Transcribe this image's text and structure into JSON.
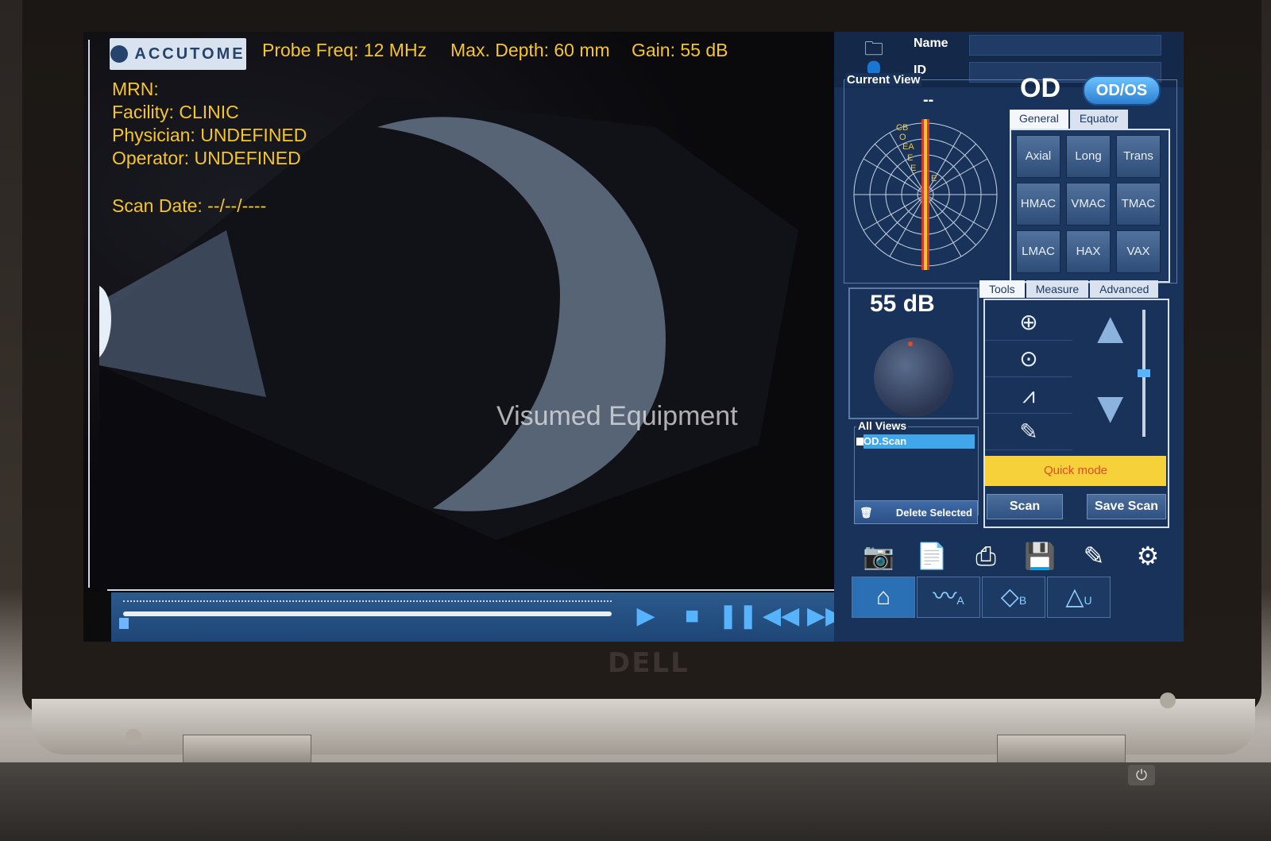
{
  "laptop": {
    "brand": "DELL",
    "power_icon": "power-icon"
  },
  "header": {
    "logo": "ACCUTOME",
    "probe_freq": "Probe Freq: 12 MHz",
    "max_depth": "Max. Depth: 60 mm",
    "gain": "Gain: 55 dB"
  },
  "patient_info": {
    "mrn": "MRN:",
    "facility": "Facility: CLINIC",
    "physician": "Physician: UNDEFINED",
    "operator": "Operator: UNDEFINED",
    "scan_date": "Scan Date: --/--/----"
  },
  "watermark": "Visumed Equipment",
  "patient_fields": {
    "name_label": "Name",
    "id_label": "ID"
  },
  "current_view": {
    "label": "Current View",
    "eye": "OD",
    "toggle": "OD/OS",
    "dash": "--",
    "clock_labels": [
      "CB",
      "O",
      "EA",
      "E",
      "E",
      "E"
    ]
  },
  "view_tabs": [
    "General",
    "Equator"
  ],
  "view_buttons": [
    "Axial",
    "Long",
    "Trans",
    "HMAC",
    "VMAC",
    "TMAC",
    "LMAC",
    "HAX",
    "VAX"
  ],
  "gain_panel": {
    "value": "55 dB"
  },
  "all_views": {
    "label": "All Views",
    "items": [
      "OD.Scan"
    ],
    "delete": "Delete Selected"
  },
  "tools_tabs": [
    "Tools",
    "Measure",
    "Advanced"
  ],
  "tools": {
    "quick_mode": "Quick mode",
    "scan": "Scan",
    "save_scan": "Save Scan"
  },
  "nav_badges": {
    "a": "A",
    "b": "B",
    "u": "U"
  },
  "colors": {
    "accent_yellow": "#f5c52a",
    "panel_blue": "#18325a",
    "highlight_blue": "#41a7ea"
  }
}
